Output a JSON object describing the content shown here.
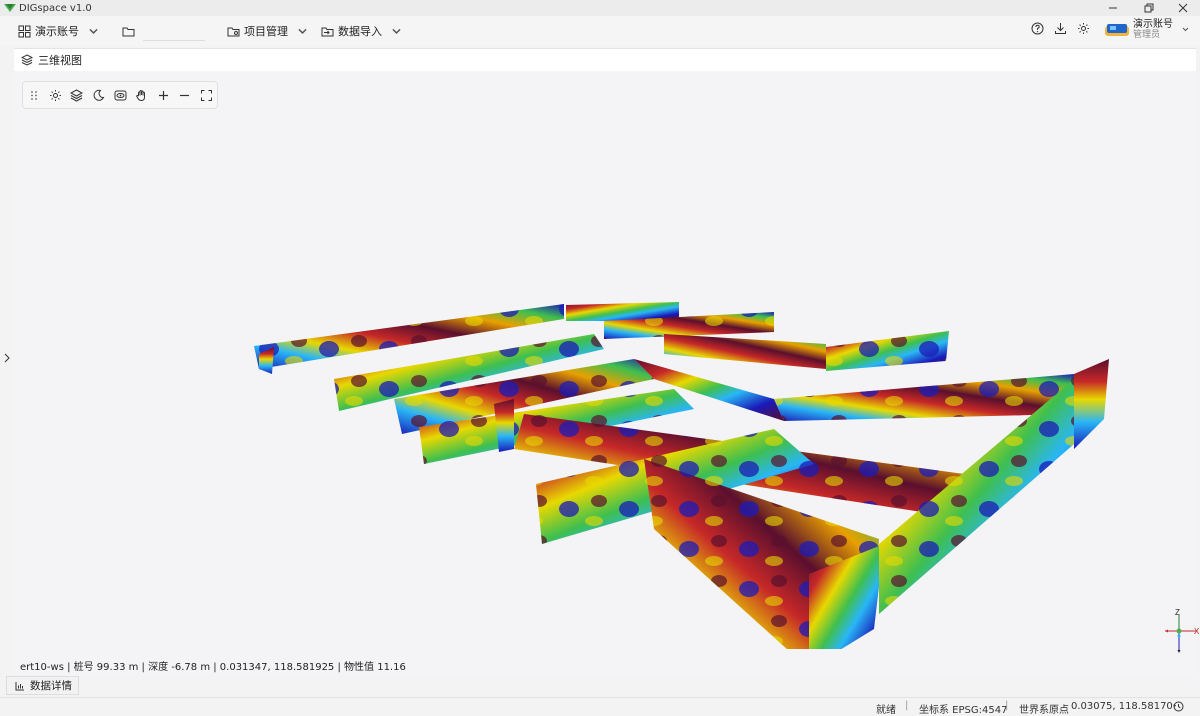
{
  "window": {
    "title": "DIGspace v1.0",
    "controls": [
      "minimize-icon",
      "restore-icon",
      "close-icon"
    ]
  },
  "toolbar": {
    "account_label": "演示账号",
    "project_label": "项目管理",
    "import_label": "数据导入",
    "folder_value": ""
  },
  "user": {
    "name": "演示账号",
    "role": "管理员"
  },
  "panel": {
    "title": "三维视图"
  },
  "view_tools": [
    "settings-icon",
    "layers-icon",
    "night-mode-icon",
    "view-icon",
    "pan-hand-icon",
    "zoom-in-icon",
    "zoom-out-icon",
    "fullscreen-icon"
  ],
  "readout": {
    "text": "ert10-ws | 桩号 99.33 m | 深度 -6.78 m | 0.031347, 118.581925 | 物性值 11.16"
  },
  "axes": {
    "z_label": "Z",
    "x_label": "X"
  },
  "detail_tab": {
    "label": "数据详情"
  },
  "status": {
    "state": "就绪",
    "crs_label": "坐标系 EPSG:4547",
    "origin_label": "世界系原点",
    "origin_value": "0.03075, 118.58170"
  },
  "colors": {
    "accent": "#4caf50",
    "deep_blue": "#1a1ab8",
    "red": "#c62828",
    "dark_red": "#5a0f2e",
    "yellow": "#e8d800",
    "cyan": "#29b6f6"
  }
}
